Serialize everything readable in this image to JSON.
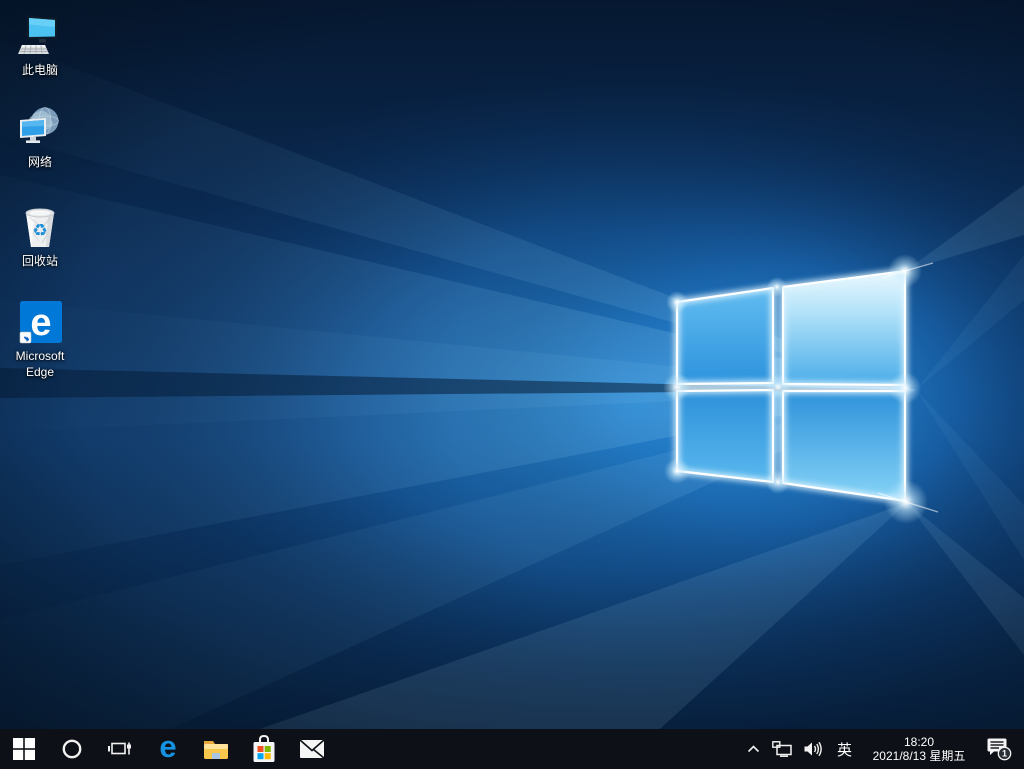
{
  "desktop": {
    "icons": [
      {
        "id": "this-pc",
        "label": "此电脑"
      },
      {
        "id": "network",
        "label": "网络"
      },
      {
        "id": "recycle-bin",
        "label": "回收站"
      },
      {
        "id": "microsoft-edge",
        "label": "Microsoft Edge"
      }
    ]
  },
  "taskbar": {
    "buttons": [
      {
        "name": "start"
      },
      {
        "name": "cortana-search"
      },
      {
        "name": "task-view"
      },
      {
        "name": "microsoft-edge"
      },
      {
        "name": "file-explorer"
      },
      {
        "name": "microsoft-store"
      },
      {
        "name": "mail"
      }
    ],
    "glyphs": {
      "edge_letter": "e"
    }
  },
  "tray": {
    "icons": [
      "hidden-icons-chevron",
      "network",
      "volume",
      "action-center"
    ],
    "ime_indicator": "英",
    "clock": {
      "time": "18:20",
      "date": "2021/8/13 星期五"
    },
    "notification_badge": "1"
  },
  "colors": {
    "taskbar_bg": "#0d1016",
    "accent_blue": "#0078d7",
    "edge_blue": "#1593e2",
    "folder_yellow": "#f8cf5a",
    "store_red": "#f25022",
    "store_green": "#7fba00",
    "store_blue": "#00a4ef",
    "store_yellow": "#ffb900",
    "wallpaper_dark": "#061a33",
    "wallpaper_bright": "#2f9ae4"
  }
}
